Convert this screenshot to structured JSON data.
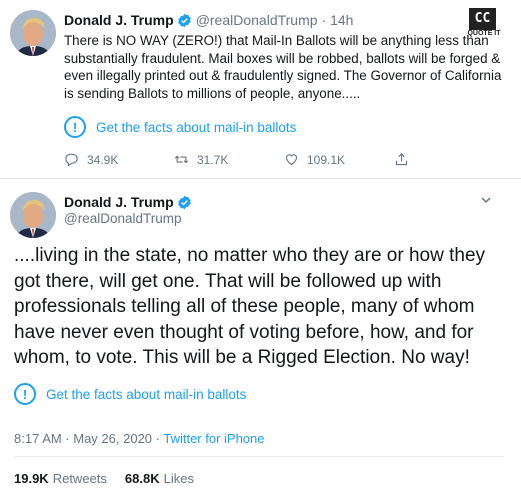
{
  "tweet1": {
    "name": "Donald J. Trump",
    "handle": "@realDonaldTrump",
    "time": "· 14h",
    "body_lines": [
      "There is NO WAY (ZERO!) that Mail-In Ballots will be anything less than",
      "substantially fraudulent. Mail boxes will be robbed, ballots will be forged &",
      "even illegally printed out & fraudulently signed. The Governor of California",
      "is sending Ballots to millions of people, anyone....."
    ],
    "facts_label": "Get the facts about mail-in ballots",
    "reply_count": "34.9K",
    "retweet_count": "31.7K",
    "like_count": "109.1K"
  },
  "tweet2": {
    "name": "Donald J. Trump",
    "handle": "@realDonaldTrump",
    "body_lines": [
      "....living in the state, no matter who they are or how they",
      "got there, will get one. That will be followed up with",
      "professionals telling all of these people, many of whom",
      "have never even thought of voting before, how, and for",
      "whom, to vote. This will be a Rigged Election. No way!"
    ],
    "facts_label": "Get the facts about mail-in ballots",
    "timestamp": "8:17 AM · May 26, 2020 · ",
    "source": "Twitter for iPhone",
    "retweets_value": "19.9K",
    "retweets_label": "Retweets",
    "likes_value": "68.8K",
    "likes_label": "Likes"
  },
  "watermark": {
    "logo_glyph": "CC",
    "label": "QUOTE IT"
  },
  "colors": {
    "accent": "#1da1f2",
    "muted": "#657786",
    "text": "#14171a"
  },
  "icons": [
    "verified-badge-icon",
    "info-exclamation-icon",
    "reply-icon",
    "retweet-icon",
    "like-heart-icon",
    "share-icon",
    "chevron-down-icon"
  ]
}
